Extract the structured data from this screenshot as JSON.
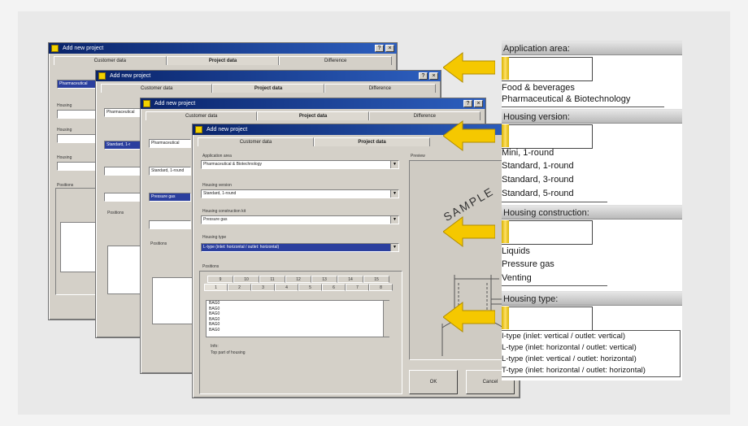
{
  "windows": {
    "title": "Add new project",
    "tabs": [
      "Customer data",
      "Project data",
      "Difference"
    ]
  },
  "front_window": {
    "application_area_label": "Application area",
    "application_area_value": "Pharmaceutical & Biotechnology",
    "housing_version_label": "Housing version",
    "housing_version_value": "Standard, 1-round",
    "housing_construction_label": "Housing construction kit",
    "housing_construction_value": "Pressure gas",
    "housing_type_label": "Housing type",
    "housing_type_value": "L-type (inlet: horizontal / outlet: horizontal)",
    "positions_label": "Positions",
    "position_tabs_row1": [
      "9",
      "10",
      "11",
      "12",
      "13",
      "14",
      "15"
    ],
    "position_tabs_row2": [
      "1",
      "2",
      "3",
      "4",
      "5",
      "6",
      "7",
      "8"
    ],
    "list_items": [
      "BAG0",
      "BAG0",
      "BAG0",
      "BAG0",
      "BAG0",
      "BAG0",
      "BAG0"
    ],
    "info_label": "Info:",
    "info_text": "Top part of housing",
    "preview_label": "Preview",
    "ok_label": "OK",
    "cancel_label": "Cancel",
    "sample_text": "SAMPLE"
  },
  "back_windows": {
    "w2_application_value": "Pharmaceutical",
    "w2_version_value": "Standard, 1-r",
    "w3_application_value": "Pharmaceutical",
    "w3_version_value": "Standard, 1-round",
    "w3_construction_value": "Pressure gas",
    "w1_application_value": "Pharmaceutical",
    "housing_label": "Housing",
    "positions_label": "Positions"
  },
  "callouts": {
    "application_area": {
      "header": "Application area:",
      "options": [
        "Food & beverages",
        "Pharmaceutical & Biotechnology"
      ]
    },
    "housing_version": {
      "header": "Housing version:",
      "options": [
        "Mini, 1-round",
        "Standard, 1-round",
        "Standard, 3-round",
        "Standard, 5-round"
      ]
    },
    "housing_construction": {
      "header": "Housing construction:",
      "options": [
        "Liquids",
        "Pressure gas",
        "Venting"
      ]
    },
    "housing_type": {
      "header": "Housing type:",
      "options": [
        "I-type (inlet: vertical / outlet: vertical)",
        "L-type (inlet: horizontal / outlet: vertical)",
        "L-type (inlet: vertical / outlet: horizontal)",
        "T-type (inlet: horizontal / outlet: horizontal)"
      ]
    }
  },
  "colors": {
    "arrow": "#f5c800",
    "titlebar": "#0a246a",
    "dialog": "#d4d0c8",
    "selection": "#2b3f9e"
  }
}
